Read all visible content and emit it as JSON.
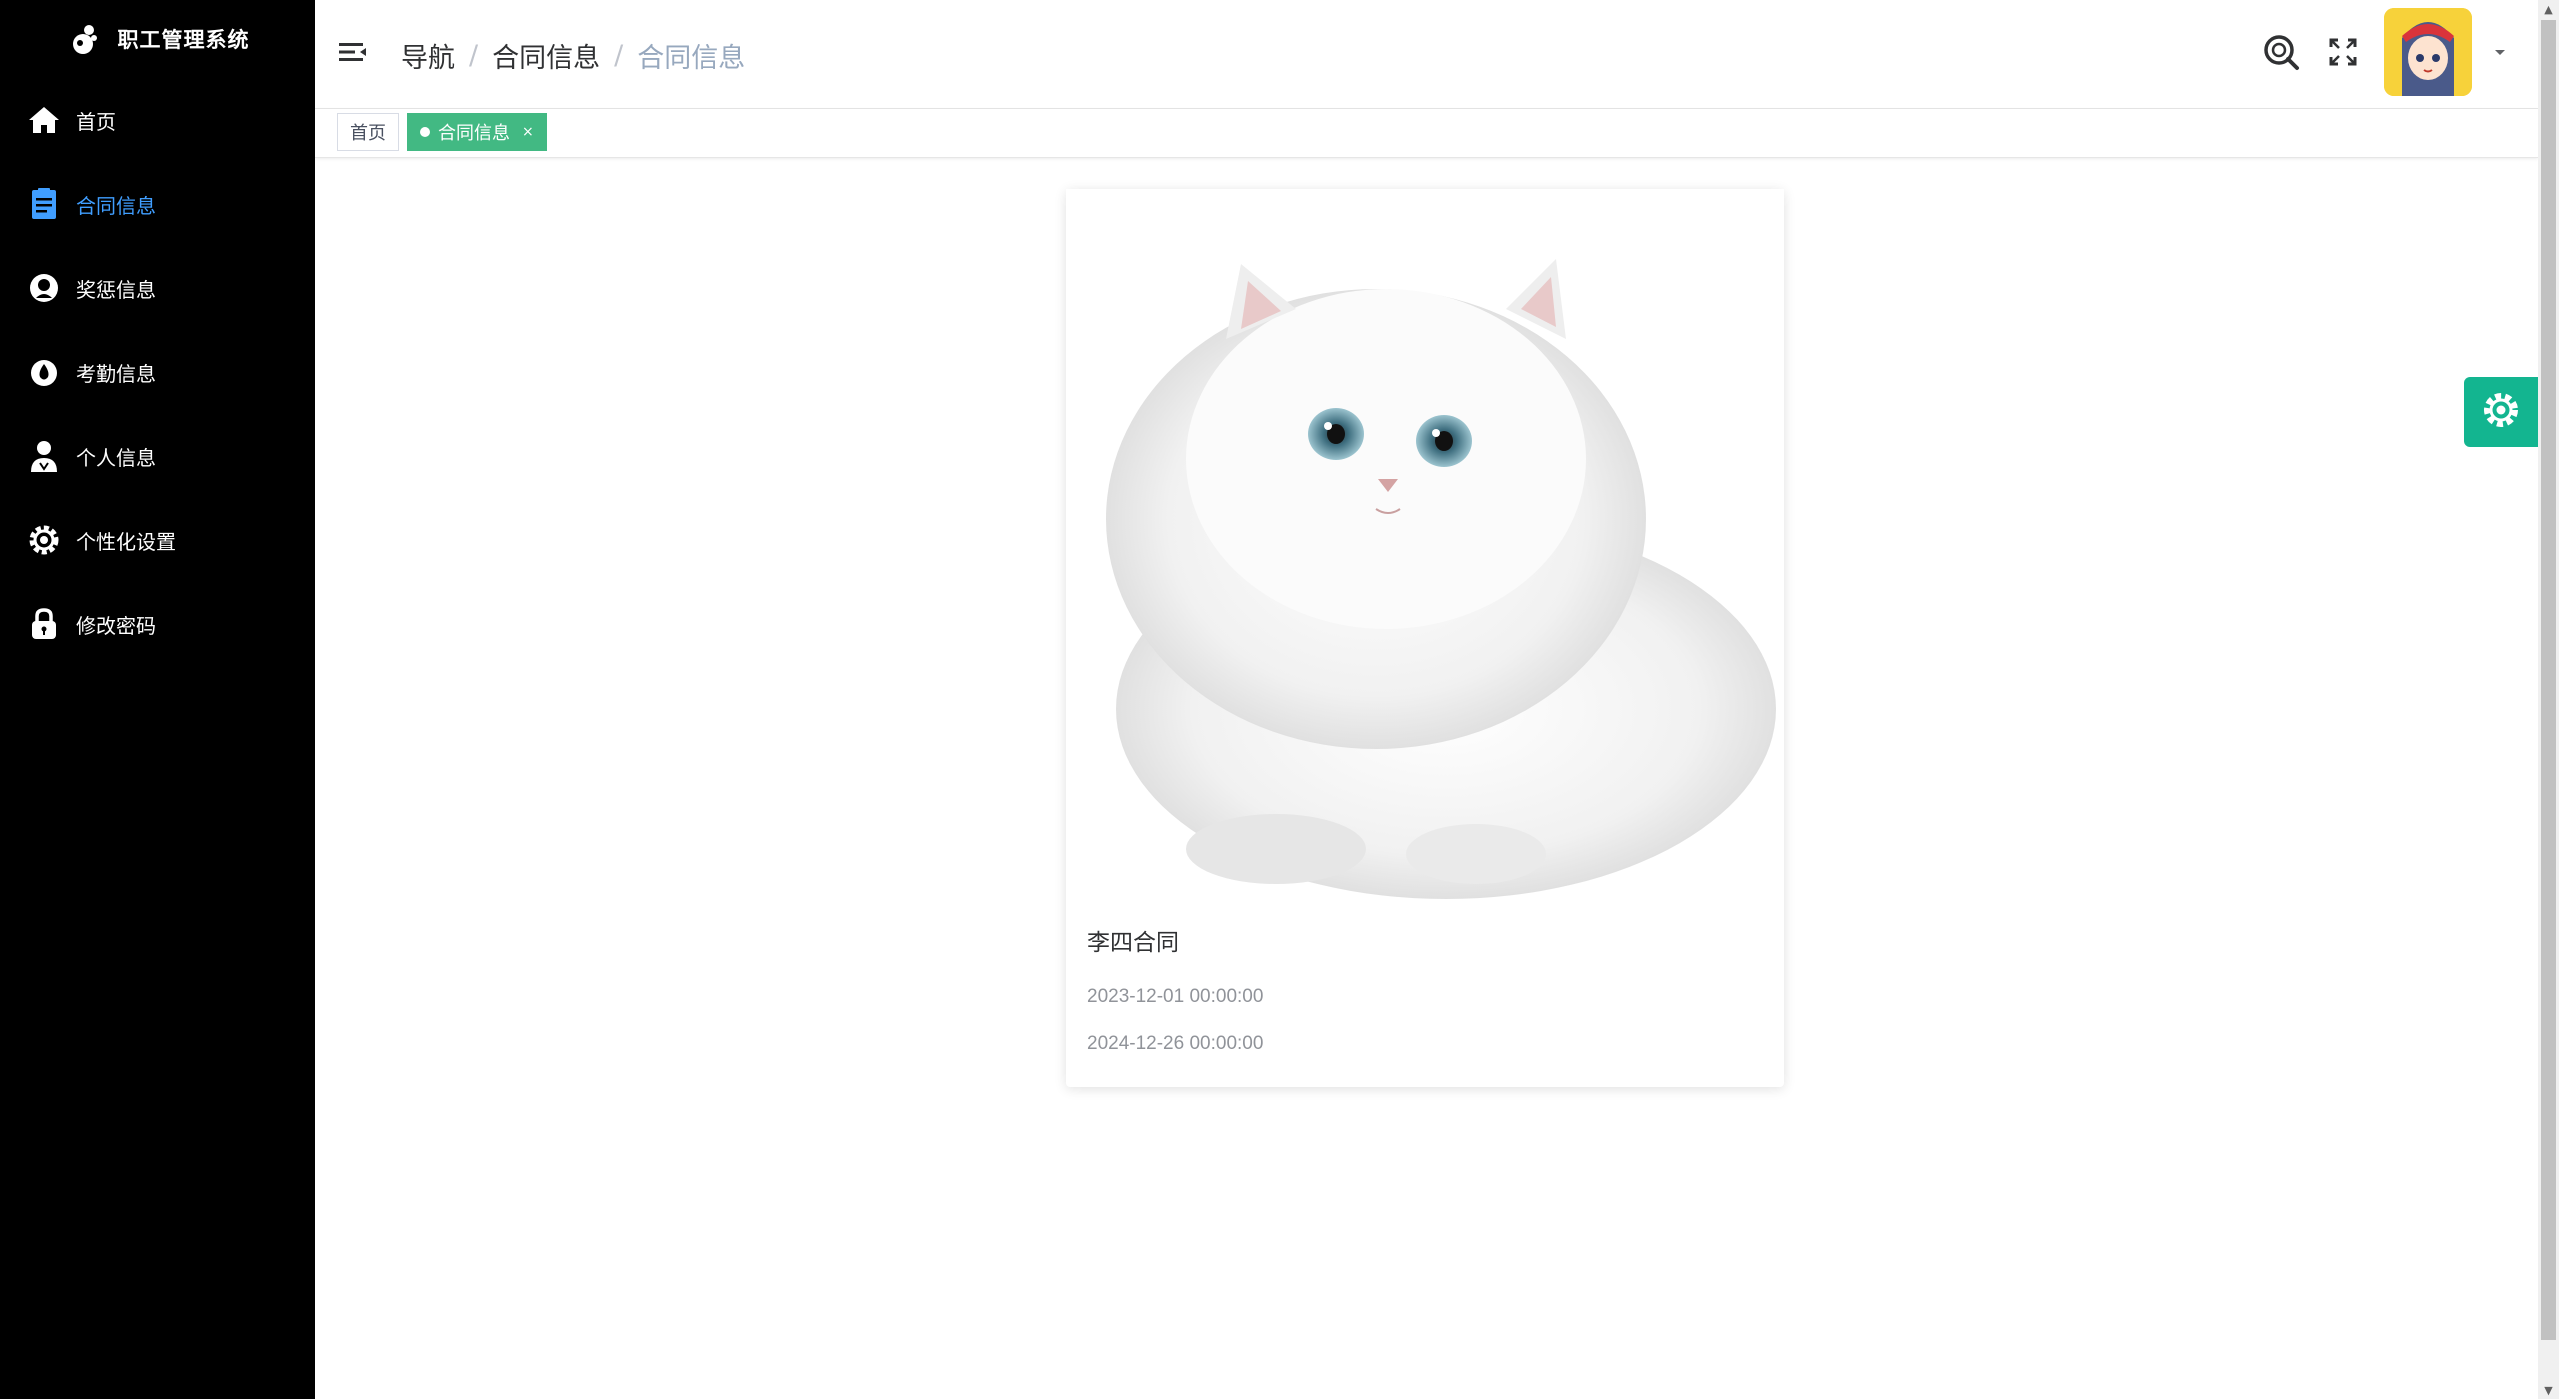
{
  "app": {
    "title": "职工管理系统"
  },
  "sidebar": {
    "items": [
      {
        "label": "首页",
        "icon": "home-icon"
      },
      {
        "label": "合同信息",
        "icon": "document-icon",
        "active": true
      },
      {
        "label": "奖惩信息",
        "icon": "award-icon"
      },
      {
        "label": "考勤信息",
        "icon": "drop-icon"
      },
      {
        "label": "个人信息",
        "icon": "user-icon"
      },
      {
        "label": "个性化设置",
        "icon": "gear-icon"
      },
      {
        "label": "修改密码",
        "icon": "lock-icon"
      }
    ]
  },
  "header": {
    "breadcrumb": [
      "导航",
      "合同信息",
      "合同信息"
    ]
  },
  "tags": [
    {
      "label": "首页"
    },
    {
      "label": "合同信息",
      "close": "×"
    }
  ],
  "card": {
    "name": "李四合同",
    "start_date": "2023-12-01 00:00:00",
    "end_date": "2024-12-26 00:00:00"
  },
  "colors": {
    "sidebar_bg": "#000000",
    "active_menu": "#409eff",
    "tag_active": "#42b983",
    "settings_button": "#13b590"
  }
}
